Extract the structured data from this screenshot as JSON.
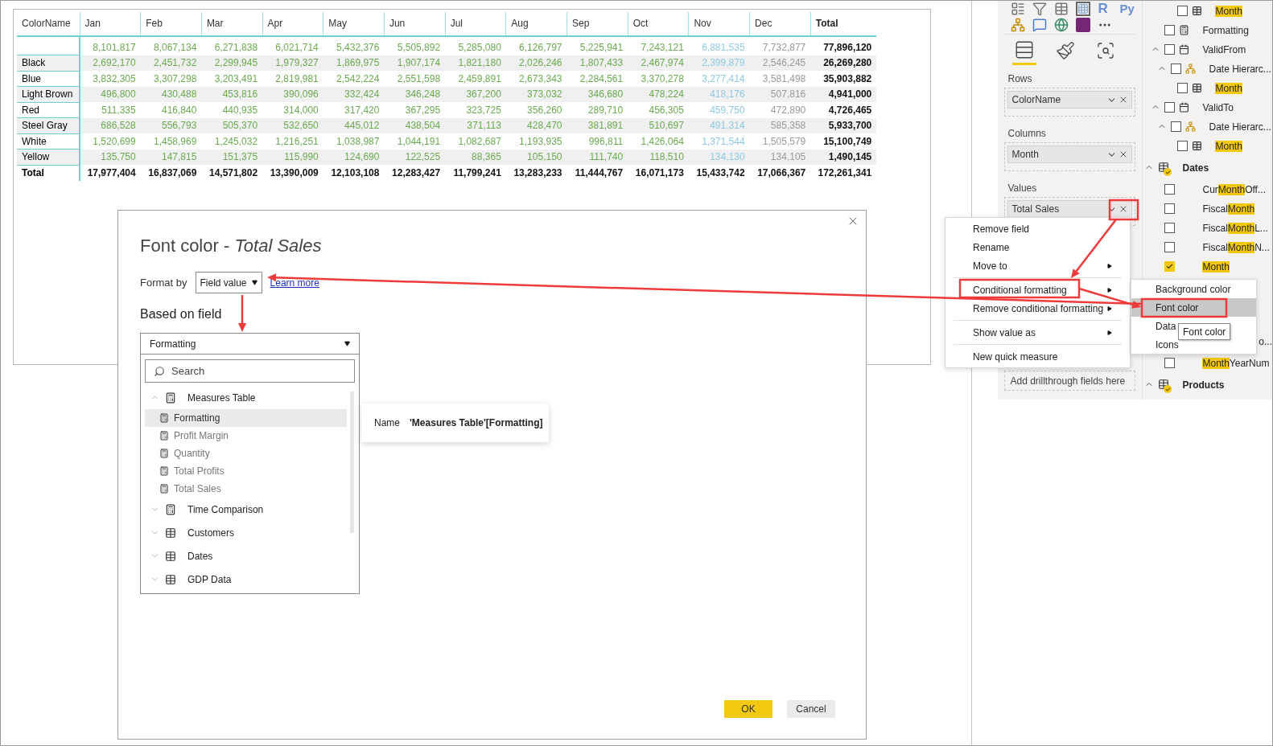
{
  "table": {
    "columns": [
      {
        "kind": "label",
        "label": "ColorName"
      },
      {
        "kind": "month",
        "label": "Jan",
        "color": "#6aab4f"
      },
      {
        "kind": "month",
        "label": "Feb",
        "color": "#6aab4f"
      },
      {
        "kind": "month",
        "label": "Mar",
        "color": "#6aab4f"
      },
      {
        "kind": "month",
        "label": "Apr",
        "color": "#6aab4f"
      },
      {
        "kind": "month",
        "label": "May",
        "color": "#6aab4f"
      },
      {
        "kind": "month",
        "label": "Jun",
        "color": "#6aab4f"
      },
      {
        "kind": "month",
        "label": "Jul",
        "color": "#6aab4f"
      },
      {
        "kind": "month",
        "label": "Aug",
        "color": "#6aab4f"
      },
      {
        "kind": "month",
        "label": "Sep",
        "color": "#6aab4f"
      },
      {
        "kind": "month",
        "label": "Oct",
        "color": "#6aab4f"
      },
      {
        "kind": "month",
        "label": "Nov",
        "color": "#8ec9e3"
      },
      {
        "kind": "month",
        "label": "Dec",
        "color": "#9a9a9a"
      },
      {
        "kind": "total",
        "label": "Total"
      }
    ],
    "rows": [
      {
        "kind": "data",
        "cells": [
          "",
          "8,101,817",
          "8,067,134",
          "6,271,838",
          "6,021,714",
          "5,432,376",
          "5,505,892",
          "5,285,080",
          "6,126,797",
          "5,225,941",
          "7,243,121",
          "6,881,535",
          "7,732,877",
          "77,896,120"
        ]
      },
      {
        "kind": "data",
        "cells": [
          "Black",
          "2,692,170",
          "2,451,732",
          "2,299,945",
          "1,979,327",
          "1,869,975",
          "1,907,174",
          "1,821,180",
          "2,026,246",
          "1,807,433",
          "2,467,974",
          "2,399,879",
          "2,546,245",
          "26,269,280"
        ]
      },
      {
        "kind": "data",
        "cells": [
          "Blue",
          "3,832,305",
          "3,307,298",
          "3,203,491",
          "2,819,981",
          "2,542,224",
          "2,551,598",
          "2,459,891",
          "2,673,343",
          "2,284,561",
          "3,370,278",
          "3,277,414",
          "3,581,498",
          "35,903,882"
        ]
      },
      {
        "kind": "data",
        "cells": [
          "Light Brown",
          "496,800",
          "430,488",
          "453,816",
          "390,096",
          "332,424",
          "346,248",
          "367,200",
          "373,032",
          "346,680",
          "478,224",
          "418,176",
          "507,816",
          "4,941,000"
        ]
      },
      {
        "kind": "data",
        "cells": [
          "Red",
          "511,335",
          "416,840",
          "440,935",
          "314,000",
          "317,420",
          "367,295",
          "323,725",
          "356,260",
          "289,710",
          "456,305",
          "459,750",
          "472,890",
          "4,726,465"
        ]
      },
      {
        "kind": "data",
        "cells": [
          "Steel Gray",
          "686,528",
          "556,793",
          "505,370",
          "532,650",
          "445,012",
          "438,504",
          "371,113",
          "428,470",
          "381,891",
          "510,697",
          "491,314",
          "585,358",
          "5,933,700"
        ]
      },
      {
        "kind": "data",
        "cells": [
          "White",
          "1,520,699",
          "1,458,969",
          "1,245,032",
          "1,216,251",
          "1,038,987",
          "1,044,191",
          "1,082,687",
          "1,193,935",
          "996,811",
          "1,426,064",
          "1,371,544",
          "1,505,579",
          "15,100,749"
        ]
      },
      {
        "kind": "data",
        "cells": [
          "Yellow",
          "135,750",
          "147,815",
          "151,375",
          "115,990",
          "124,690",
          "122,525",
          "88,365",
          "105,150",
          "111,740",
          "118,510",
          "134,130",
          "134,105",
          "1,490,145"
        ]
      },
      {
        "kind": "total",
        "cells": [
          "Total",
          "17,977,404",
          "16,837,069",
          "14,571,802",
          "13,390,009",
          "12,103,108",
          "12,283,427",
          "11,799,241",
          "13,283,233",
          "11,444,767",
          "16,071,173",
          "15,433,742",
          "17,066,367",
          "172,261,341"
        ]
      }
    ]
  },
  "visualizations": {
    "icon_labels": [
      "R",
      "Py"
    ],
    "tabs": [
      {
        "kind": "fields",
        "selected": true
      },
      {
        "kind": "format",
        "selected": false
      },
      {
        "kind": "analytics",
        "selected": false
      }
    ],
    "wells": [
      {
        "title": "Rows",
        "field": "ColorName"
      },
      {
        "title": "Columns",
        "field": "Month"
      },
      {
        "title": "Values",
        "field": "Total Sales"
      }
    ],
    "drillthrough_placeholder": "Add drillthrough fields here"
  },
  "fields": [
    {
      "children": [
        {
          "children": [
            {
              "children": [
                {
                  "kind": "column",
                  "parts": [
                    {
                      "text": "Month",
                      "match": true
                    }
                  ],
                  "checked": false
                }
              ]
            }
          ]
        },
        {
          "kind": "measure",
          "parts": [
            {
              "text": "Formatting",
              "match": false
            }
          ],
          "checked": false
        },
        {
          "kind": "date",
          "parts": [
            {
              "text": "ValidFrom",
              "match": false
            }
          ],
          "checked": false,
          "expanded": true,
          "children": [
            {
              "kind": "hierarchy",
              "parts": [
                {
                  "text": "Date Hierarc...",
                  "match": false
                }
              ],
              "checked": false,
              "expanded": true,
              "children": [
                {
                  "kind": "column",
                  "parts": [
                    {
                      "text": "Month",
                      "match": true
                    }
                  ],
                  "checked": false
                }
              ]
            }
          ]
        },
        {
          "kind": "date",
          "parts": [
            {
              "text": "ValidTo",
              "match": false
            }
          ],
          "checked": false,
          "expanded": true,
          "children": [
            {
              "kind": "hierarchy",
              "parts": [
                {
                  "text": "Date Hierarc...",
                  "match": false
                }
              ],
              "checked": false,
              "expanded": true,
              "children": [
                {
                  "kind": "column",
                  "parts": [
                    {
                      "text": "Month",
                      "match": true
                    }
                  ],
                  "checked": false
                }
              ]
            }
          ]
        }
      ]
    },
    {
      "kind": "table",
      "parts": [
        {
          "text": "Dates",
          "match": false
        }
      ],
      "used": true,
      "expanded": true,
      "children": [
        {
          "kind": "plain",
          "parts": [
            {
              "text": "Cur",
              "match": false
            },
            {
              "text": "Month",
              "match": true
            },
            {
              "text": "Off...",
              "match": false
            }
          ],
          "checked": false
        },
        {
          "kind": "plain",
          "parts": [
            {
              "text": "Fiscal",
              "match": false
            },
            {
              "text": "Month",
              "match": true
            }
          ],
          "checked": false
        },
        {
          "kind": "plain",
          "parts": [
            {
              "text": "Fiscal",
              "match": false
            },
            {
              "text": "Month",
              "match": true
            },
            {
              "text": "L...",
              "match": false
            }
          ],
          "checked": false
        },
        {
          "kind": "plain",
          "parts": [
            {
              "text": "Fiscal",
              "match": false
            },
            {
              "text": "Month",
              "match": true
            },
            {
              "text": "N...",
              "match": false
            }
          ],
          "checked": false
        },
        {
          "kind": "plain",
          "parts": [
            {
              "text": "Month",
              "match": true
            }
          ],
          "checked": true
        },
        {
          "kind": "cut",
          "parts": [
            {
              "text": "o...",
              "match": false
            }
          ]
        },
        {
          "kind": "plain",
          "parts": [
            {
              "text": "Month",
              "match": true
            },
            {
              "text": "YearNum",
              "match": false
            }
          ],
          "checked": false
        }
      ]
    },
    {
      "kind": "table",
      "parts": [
        {
          "text": "Products",
          "match": false
        }
      ],
      "used": true,
      "expanded": true
    }
  ],
  "context_menu": [
    {
      "kind": "item",
      "label": "Remove field",
      "has_submenu": false
    },
    {
      "kind": "item",
      "label": "Rename",
      "has_submenu": false
    },
    {
      "kind": "item",
      "label": "Move to",
      "has_submenu": true
    },
    {
      "kind": "separator"
    },
    {
      "kind": "item",
      "label": "Conditional formatting",
      "has_submenu": true
    },
    {
      "kind": "item",
      "label": "Remove conditional formatting",
      "has_submenu": true
    },
    {
      "kind": "separator"
    },
    {
      "kind": "item",
      "label": "Show value as",
      "has_submenu": true
    },
    {
      "kind": "separator"
    },
    {
      "kind": "item",
      "label": "New quick measure",
      "has_submenu": false
    }
  ],
  "submenu": [
    {
      "label": "Background color",
      "selected": false
    },
    {
      "label": "Font color",
      "selected": true
    },
    {
      "label": "Data",
      "selected": false
    },
    {
      "label": "Icons",
      "selected": false
    }
  ],
  "submenu_tooltip": "Font color",
  "dialog": {
    "title": "Font color - *Total Sales*",
    "format_by_label": "Format by",
    "format_by_value": "Field value",
    "learn_more": "Learn more",
    "based_on_label": "Based on field",
    "field_value": "Formatting",
    "search_placeholder": "Search",
    "tree": [
      {
        "kind": "measure-table",
        "label": "Measures Table",
        "expanded": true,
        "children": [
          {
            "label": "Formatting",
            "selected": true
          },
          {
            "label": "Profit Margin",
            "selected": false
          },
          {
            "label": "Quantity",
            "selected": false
          },
          {
            "label": "Total Profits",
            "selected": false
          },
          {
            "label": "Total Sales",
            "selected": false
          }
        ]
      },
      {
        "kind": "measure-table",
        "label": "Time Comparison",
        "expanded": false
      },
      {
        "kind": "table",
        "label": "Customers",
        "expanded": false
      },
      {
        "kind": "table",
        "label": "Dates",
        "expanded": false
      },
      {
        "kind": "table",
        "label": "GDP Data",
        "expanded": false
      }
    ],
    "tooltip": {
      "key": "Name",
      "value": "'Measures Table'[Formatting]"
    },
    "buttons": [
      {
        "kind": "primary",
        "label": "OK"
      },
      {
        "kind": "secondary",
        "label": "Cancel"
      }
    ]
  }
}
